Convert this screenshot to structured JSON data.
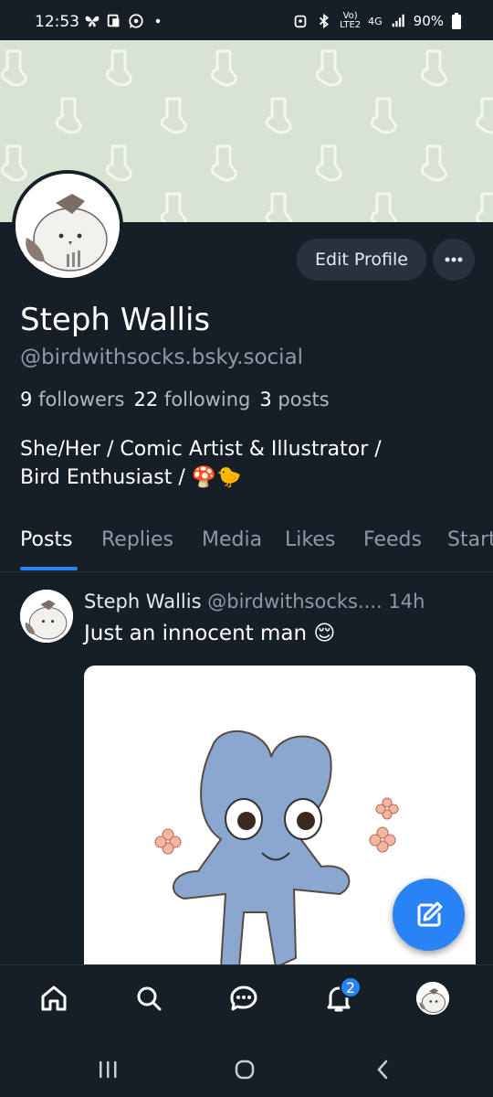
{
  "status_bar": {
    "time": "12:53",
    "battery": "90%",
    "network_top": "Vo)",
    "network_bottom": "LTE2",
    "signal_label": "4G"
  },
  "profile": {
    "edit_label": "Edit Profile",
    "name": "Steph Wallis",
    "handle": "@birdwithsocks.bsky.social",
    "followers_count": "9",
    "followers_label": "followers",
    "following_count": "22",
    "following_label": "following",
    "posts_count": "3",
    "posts_label": "posts",
    "bio_line1": "She/Her / Comic Artist & Illustrator /",
    "bio_line2": "Bird Enthusiast / 🍄🐤"
  },
  "tabs": [
    "Posts",
    "Replies",
    "Media",
    "Likes",
    "Feeds",
    "Starter Packs"
  ],
  "post": {
    "author": "Steph Wallis",
    "handle": "@birdwithsocks....",
    "time": "14h",
    "text": "Just an innocent man 😌"
  },
  "bottom_nav": {
    "notification_count": "2"
  },
  "colors": {
    "background": "#161e27",
    "accent": "#2a83f5",
    "banner": "#d9e3d4",
    "muted_text": "#8d9aa7"
  }
}
